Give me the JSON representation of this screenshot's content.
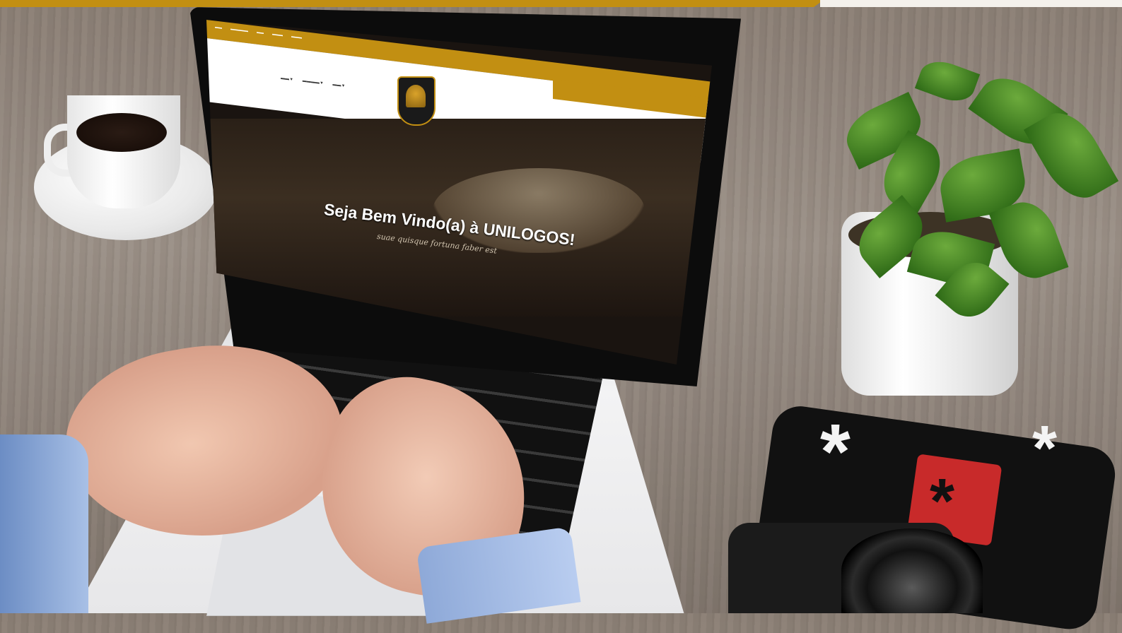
{
  "website": {
    "hero_title": "Seja Bem Vindo(a) à UNILOGOS!",
    "hero_subtitle": "suae quisque fortuna faber est"
  },
  "colors": {
    "brand_gold": "#c28f12",
    "wood": "#8a7e74"
  }
}
